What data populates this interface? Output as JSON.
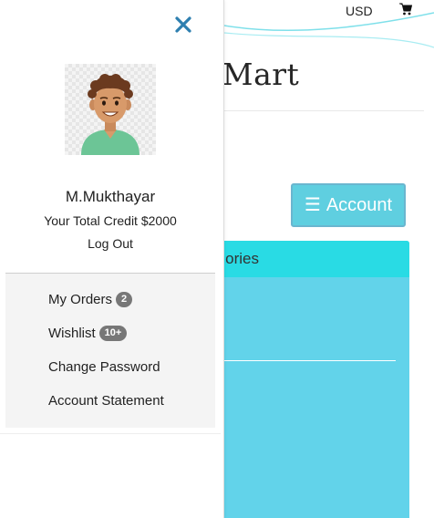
{
  "header": {
    "currency": "USD",
    "brand_text": "ni Mart"
  },
  "account_button": {
    "label": "Account",
    "icon": "hamburger-icon"
  },
  "categories": {
    "header_label": "ories"
  },
  "drawer": {
    "close_icon": "close-icon",
    "avatar": "user-avatar",
    "user_name": "M.Mukthayar",
    "credit_text": "Your Total Credit $2000",
    "logout_label": "Log Out",
    "menu": [
      {
        "label": "My Orders",
        "badge": "2"
      },
      {
        "label": "Wishlist",
        "badge": "10+"
      },
      {
        "label": "Change Password",
        "badge": ""
      },
      {
        "label": "Account Statement",
        "badge": ""
      }
    ]
  },
  "colors": {
    "accent_teal": "#29dbe4",
    "panel_blue": "#62d3ea",
    "account_button": "#5fcfe0",
    "close_icon": "#2e7fb0",
    "badge": "#777777"
  }
}
